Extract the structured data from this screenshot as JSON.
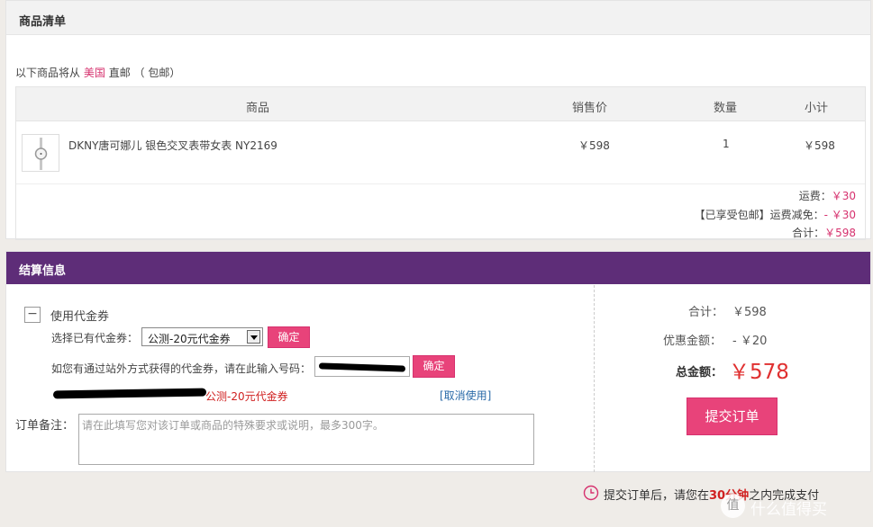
{
  "goods_list": {
    "title": "商品清单",
    "ship_prefix": "以下商品将从",
    "ship_country": "美国",
    "ship_mode": "直邮",
    "ship_note": "（ 包邮）",
    "columns": [
      "商品",
      "销售价",
      "数量",
      "小计"
    ],
    "items": [
      {
        "name": "DKNY唐可娜儿 银色交叉表带女表 NY2169",
        "price": "￥598",
        "qty": "1",
        "subtotal": "￥598",
        "icon": "watch-thumbnail"
      }
    ],
    "shipping_label": "运费：",
    "shipping_value": "￥30",
    "free_ship_label": "【已享受包邮】运费减免：",
    "free_ship_value": "- ￥30",
    "total_label": "合计：",
    "total_value": "￥598"
  },
  "settlement": {
    "title": "结算信息",
    "toggle_symbol": "−",
    "use_coupon_label": "使用代金券",
    "select_existing_label": "选择已有代金券：",
    "selected_coupon": "公测-20元代金券",
    "confirm_label": "确定",
    "external_code_label": "如您有通过站外方式获得的代金券，请在此输入号码：",
    "applied_coupon": "公测-20元代金券",
    "cancel_use_label": "[取消使用]",
    "remark_label": "订单备注：",
    "remark_placeholder": "请在此填写您对该订单或商品的特殊要求或说明，最多300字。",
    "summary": {
      "subtotal_label": "合计：",
      "subtotal_value": "￥598",
      "discount_label": "优惠金额：",
      "discount_value": "- ￥20",
      "grand_label": "总金额：",
      "grand_value": "￥578"
    },
    "submit_label": "提交订单"
  },
  "footer": {
    "icon": "clock-icon",
    "note_before": "提交订单后，请您在",
    "note_highlight": "30分钟",
    "note_after": "之内完成支付"
  },
  "watermark": "值 什么值得买",
  "colors": {
    "accent": "#e8437a",
    "header_purple": "#5e2d78",
    "price_red": "#e03030"
  }
}
